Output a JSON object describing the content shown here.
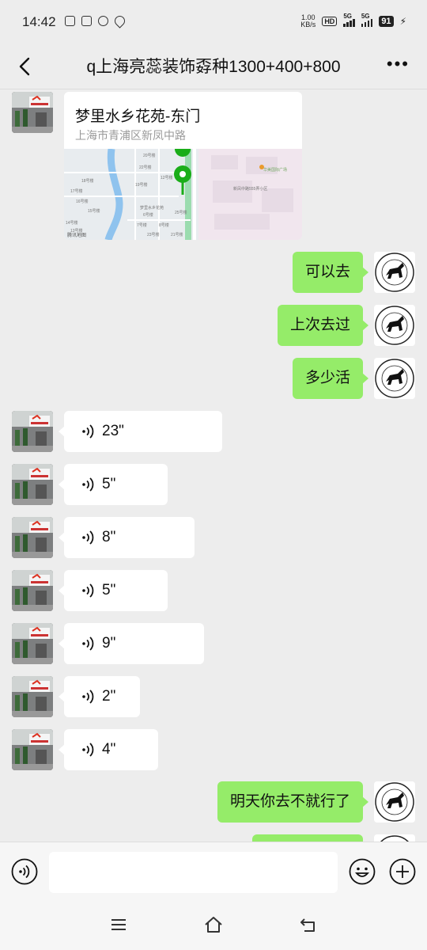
{
  "status_bar": {
    "time": "14:42",
    "net_speed_value": "1.00",
    "net_speed_unit": "KB/s",
    "hd": "HD",
    "signal1": "5G",
    "signal2": "5G",
    "battery": "91"
  },
  "header": {
    "title": "q上海亮蕊装饰孬种1300+400+800"
  },
  "location_card": {
    "name": "梦里水乡花苑-东门",
    "address": "上海市青浦区新凤中路",
    "map_labels": [
      "20号楼",
      "22号楼",
      "12号楼",
      "19号楼",
      "18号楼",
      "17号楼",
      "16号楼",
      "15号楼",
      "14号楼",
      "13号楼",
      "梦里水乡花苑",
      "6号楼",
      "7号楼",
      "8号楼",
      "21号楼",
      "25号楼",
      "23号楼",
      "华美国际广场",
      "新凤中路555弄小区"
    ],
    "map_brand": "腾讯地图"
  },
  "messages": [
    {
      "side": "right",
      "type": "text",
      "text": "可以去"
    },
    {
      "side": "right",
      "type": "text",
      "text": "上次去过"
    },
    {
      "side": "right",
      "type": "text",
      "text": "多少活"
    },
    {
      "side": "left",
      "type": "voice",
      "duration": "23\""
    },
    {
      "side": "left",
      "type": "voice",
      "duration": "5\""
    },
    {
      "side": "left",
      "type": "voice",
      "duration": "8\""
    },
    {
      "side": "left",
      "type": "voice",
      "duration": "5\""
    },
    {
      "side": "left",
      "type": "voice",
      "duration": "9\""
    },
    {
      "side": "left",
      "type": "voice",
      "duration": "2\""
    },
    {
      "side": "left",
      "type": "voice",
      "duration": "4\""
    },
    {
      "side": "right",
      "type": "text",
      "text": "明天你去不就行了"
    }
  ],
  "colors": {
    "sent_bubble": "#95ec69",
    "received_bubble": "#ffffff",
    "background": "#ededed",
    "map_pin": "#07c160"
  },
  "icons": {
    "back": "chevron-left-icon",
    "more": "more-dots-icon",
    "voice_mode": "voice-input-icon",
    "emoji": "emoji-icon",
    "add": "plus-circle-icon"
  }
}
